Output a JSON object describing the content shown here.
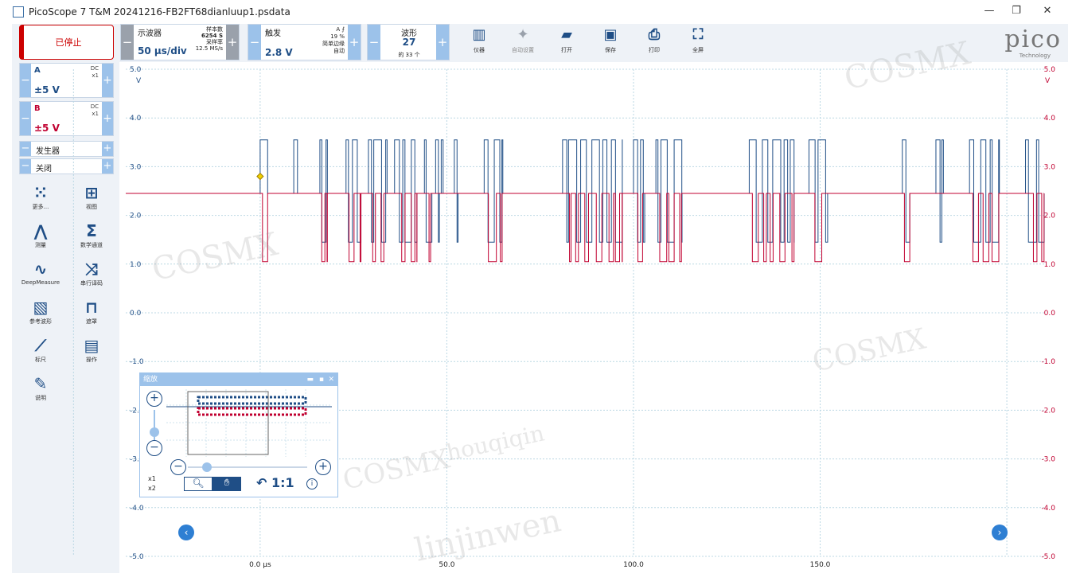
{
  "window": {
    "title": "PicoScope 7 T&M 20241216-FB2FT68dianluup1.psdata",
    "min": "—",
    "max": "❐",
    "close": "✕"
  },
  "left": {
    "stop_label": "已停止",
    "channels": [
      {
        "name": "A",
        "coupling": "DC",
        "probe": "x1",
        "range": "±5 V",
        "color": "#1f4e86"
      },
      {
        "name": "B",
        "coupling": "DC",
        "probe": "x1",
        "range": "±5 V",
        "color": "#c00030"
      }
    ],
    "generator": {
      "label": "发生器",
      "state": "关闭"
    },
    "tools": [
      {
        "label": "更多...",
        "icon": "grid-dots-icon"
      },
      {
        "label": "视图",
        "icon": "view-grid-icon"
      },
      {
        "label": "测量",
        "icon": "compass-icon"
      },
      {
        "label": "数学通道",
        "icon": "sigma-icon"
      },
      {
        "label": "DeepMeasure",
        "icon": "deepmeasure-icon"
      },
      {
        "label": "串行译码",
        "icon": "serial-decode-icon"
      },
      {
        "label": "参考波形",
        "icon": "reference-wave-icon"
      },
      {
        "label": "遮罩",
        "icon": "mask-icon"
      },
      {
        "label": "标尺",
        "icon": "ruler-icon"
      },
      {
        "label": "操作",
        "icon": "clapper-icon"
      },
      {
        "label": "说明",
        "icon": "note-icon"
      }
    ]
  },
  "toolbar": {
    "scope": {
      "title": "示波器",
      "timebase": "50 μs/div",
      "samples_label": "样本数",
      "samples": "6254 S",
      "rate_label": "采样率",
      "rate": "12.5 MS/s"
    },
    "trigger": {
      "title": "触发",
      "channel": "A",
      "percent": "19 %",
      "type": "简单边缘",
      "mode": "自动",
      "level": "2.8 V"
    },
    "waveform": {
      "title": "波形",
      "current": "27",
      "of": "的 33 个"
    },
    "buttons": [
      {
        "label": "仪器",
        "icon": "instrument-icon"
      },
      {
        "label": "自动设置",
        "icon": "auto-setup-icon"
      },
      {
        "label": "打开",
        "icon": "folder-open-icon"
      },
      {
        "label": "保存",
        "icon": "save-icon"
      },
      {
        "label": "打印",
        "icon": "print-icon"
      },
      {
        "label": "全屏",
        "icon": "fullscreen-icon"
      }
    ],
    "logo": "pico",
    "logo_sub": "Technology"
  },
  "chart_data": {
    "type": "line",
    "x_unit": "μs",
    "xlim": [
      -36,
      210
    ],
    "x_ticks": [
      "0.0 μs",
      "50.0",
      "100.0",
      "150.0"
    ],
    "y_left": {
      "unit": "V",
      "ticks": [
        "5.0",
        "4.0",
        "3.0",
        "2.0",
        "1.0",
        "0.0",
        "-1.0",
        "-2.0",
        "-3.0",
        "-4.0",
        "-5.0"
      ]
    },
    "y_right": {
      "unit": "V",
      "ticks": [
        "5.0",
        "4.0",
        "3.0",
        "2.0",
        "1.0",
        "0.0",
        "-1.0",
        "-2.0",
        "-3.0",
        "-4.0",
        "-5.0"
      ]
    },
    "ylim": [
      -5,
      5
    ],
    "trigger_level": 2.8,
    "series": [
      {
        "name": "A",
        "color": "#1f4e86",
        "idle": 2.45,
        "high": 3.55,
        "low": 1.45
      },
      {
        "name": "B",
        "color": "#c00030",
        "idle": 2.45,
        "high": 2.45,
        "low": 1.05
      }
    ],
    "bursts": [
      [
        0,
        2
      ],
      [
        9,
        10
      ],
      [
        16,
        18
      ],
      [
        23,
        27
      ],
      [
        29,
        34
      ],
      [
        36,
        42
      ],
      [
        44,
        46
      ],
      [
        47,
        48
      ],
      [
        48.5,
        49
      ],
      [
        52,
        53
      ],
      [
        60,
        65
      ],
      [
        81,
        97
      ],
      [
        100,
        103
      ],
      [
        106,
        113
      ],
      [
        131,
        143
      ],
      [
        147,
        152
      ],
      [
        172,
        174
      ],
      [
        181,
        183
      ],
      [
        190,
        198
      ],
      [
        205,
        210
      ]
    ]
  },
  "zoom": {
    "title": "缩放",
    "ratio": "1:1",
    "x1": "x1",
    "x2": "x2"
  }
}
